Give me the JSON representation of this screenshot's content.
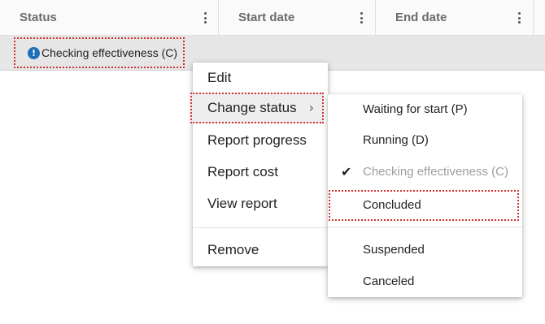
{
  "table": {
    "columns": [
      {
        "label": "Status"
      },
      {
        "label": "Start date"
      },
      {
        "label": "End date"
      }
    ],
    "row": {
      "status_icon": "info-icon",
      "status_label": "Checking effectiveness (C)"
    }
  },
  "context_menu": {
    "items": [
      {
        "label": "Edit"
      },
      {
        "label": "Change status"
      },
      {
        "label": "Report progress"
      },
      {
        "label": "Report cost"
      },
      {
        "label": "View report"
      },
      {
        "label": "Remove"
      }
    ]
  },
  "status_submenu": {
    "items": [
      {
        "label": "Waiting for start (P)"
      },
      {
        "label": "Running (D)"
      },
      {
        "label": "Checking effectiveness (C)",
        "checked": true,
        "disabled": true
      },
      {
        "label": "Concluded"
      },
      {
        "label": "Suspended"
      },
      {
        "label": "Canceled"
      }
    ]
  },
  "colors": {
    "highlight_outline": "#d32f2f",
    "info_icon": "#1e6fb8",
    "row_selected": "#e6e6e6"
  }
}
